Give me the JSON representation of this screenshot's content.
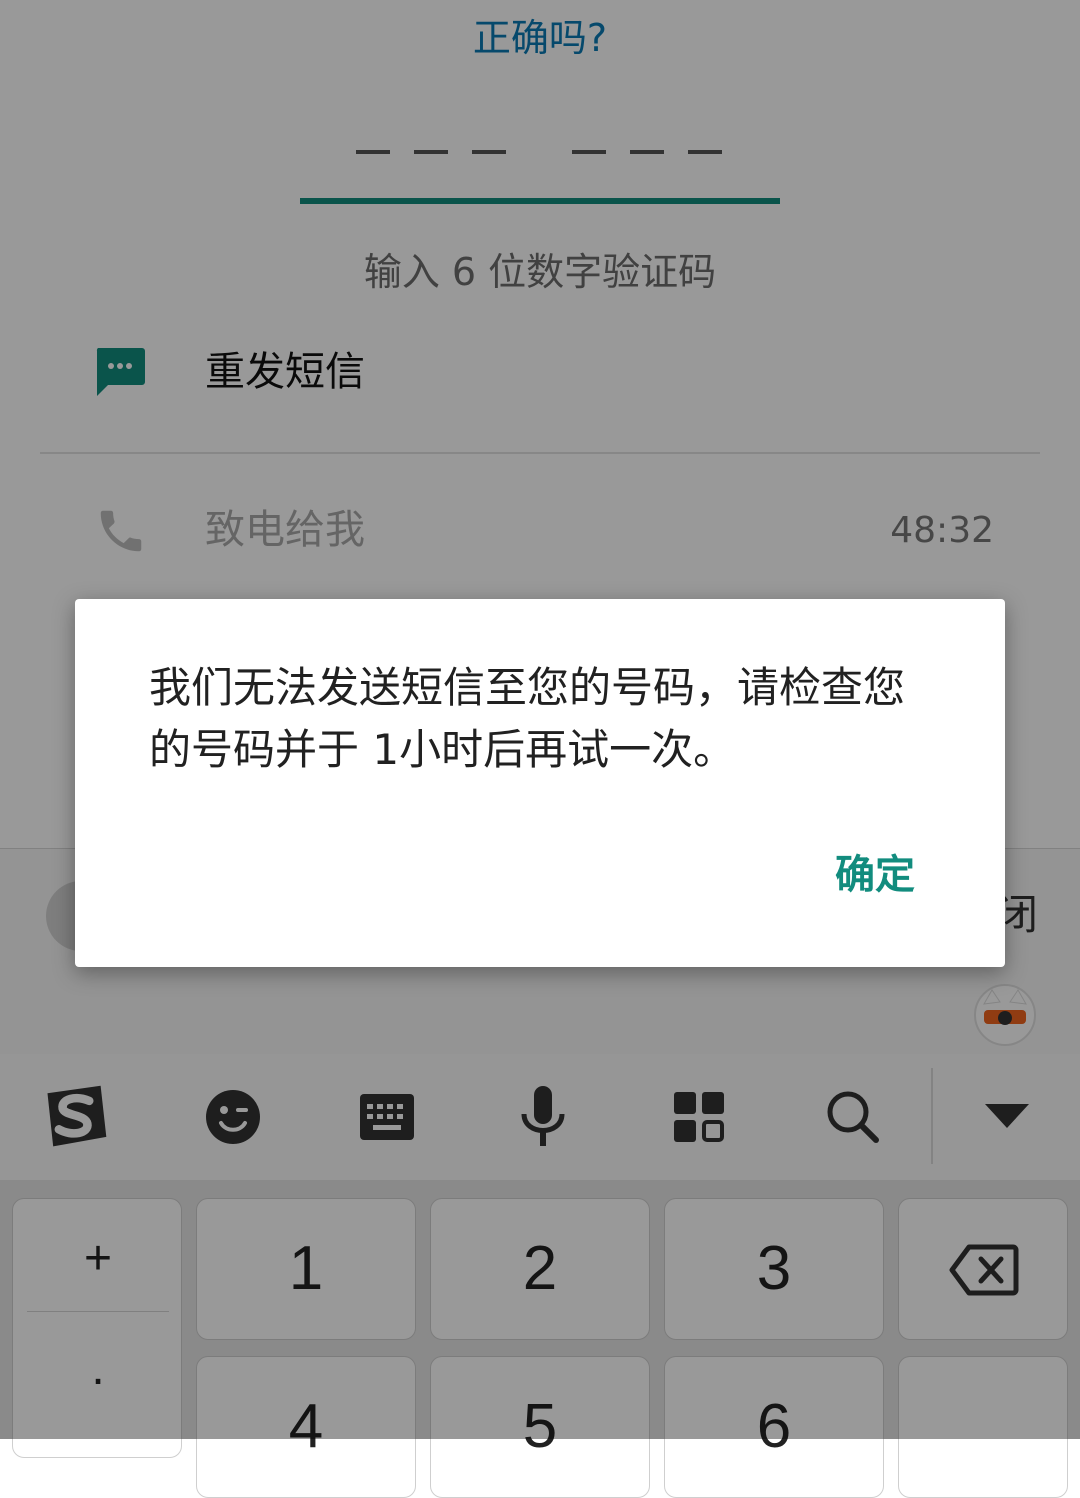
{
  "header": {
    "wrong_number_link": "正确吗?"
  },
  "verification": {
    "code_placeholder": "___ ___",
    "hint": "输入 6 位数字验证码"
  },
  "options": {
    "resend_sms_label": "重发短信",
    "call_me_label": "致电给我",
    "call_timer": "48:32"
  },
  "partial_background": {
    "close_text": "闭"
  },
  "dialog": {
    "message": "我们无法发送短信至您的号码，请检查您的号码并于 1小时后再试一次。",
    "ok_label": "确定"
  },
  "keyboard": {
    "toolbar_icons": [
      "sogou-logo-icon",
      "emoji-icon",
      "keyboard-icon",
      "microphone-icon",
      "grid-icon",
      "search-icon",
      "collapse-icon"
    ],
    "side_keys": [
      "+",
      "."
    ],
    "keys": [
      "1",
      "2",
      "3",
      "4",
      "5",
      "6"
    ],
    "backspace_icon": "backspace-icon"
  },
  "colors": {
    "accent": "#128c7e",
    "link": "#0b7bb5",
    "scrim": "rgba(0,0,0,0.40)"
  }
}
